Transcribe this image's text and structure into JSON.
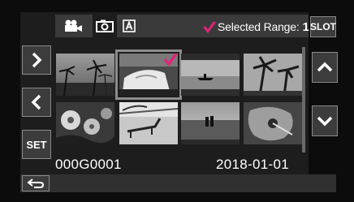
{
  "tabs": [
    {
      "name": "video-tab",
      "icon": "video-camera-icon",
      "active": false
    },
    {
      "name": "photo-tab",
      "icon": "camera-icon",
      "active": true
    },
    {
      "name": "auto-tab",
      "icon": "letter-a-icon",
      "active": false
    }
  ],
  "selection": {
    "label": "Selected Range:",
    "count": "1",
    "accent": "#e0257a"
  },
  "buttons": {
    "slot": "SLOT",
    "set": "SET"
  },
  "thumbnails": [
    {
      "subject": "palm-trees-sunset",
      "selected": false
    },
    {
      "subject": "person-on-beach-towel",
      "selected": true
    },
    {
      "subject": "canoe-on-lake",
      "selected": false
    },
    {
      "subject": "palm-silhouettes",
      "selected": false
    },
    {
      "subject": "tropical-flowers",
      "selected": false
    },
    {
      "subject": "beach-lounger",
      "selected": false
    },
    {
      "subject": "couple-at-sea",
      "selected": false
    },
    {
      "subject": "hibiscus-flower",
      "selected": false
    }
  ],
  "info": {
    "filename": "000G0001",
    "date": "2018-01-01"
  }
}
